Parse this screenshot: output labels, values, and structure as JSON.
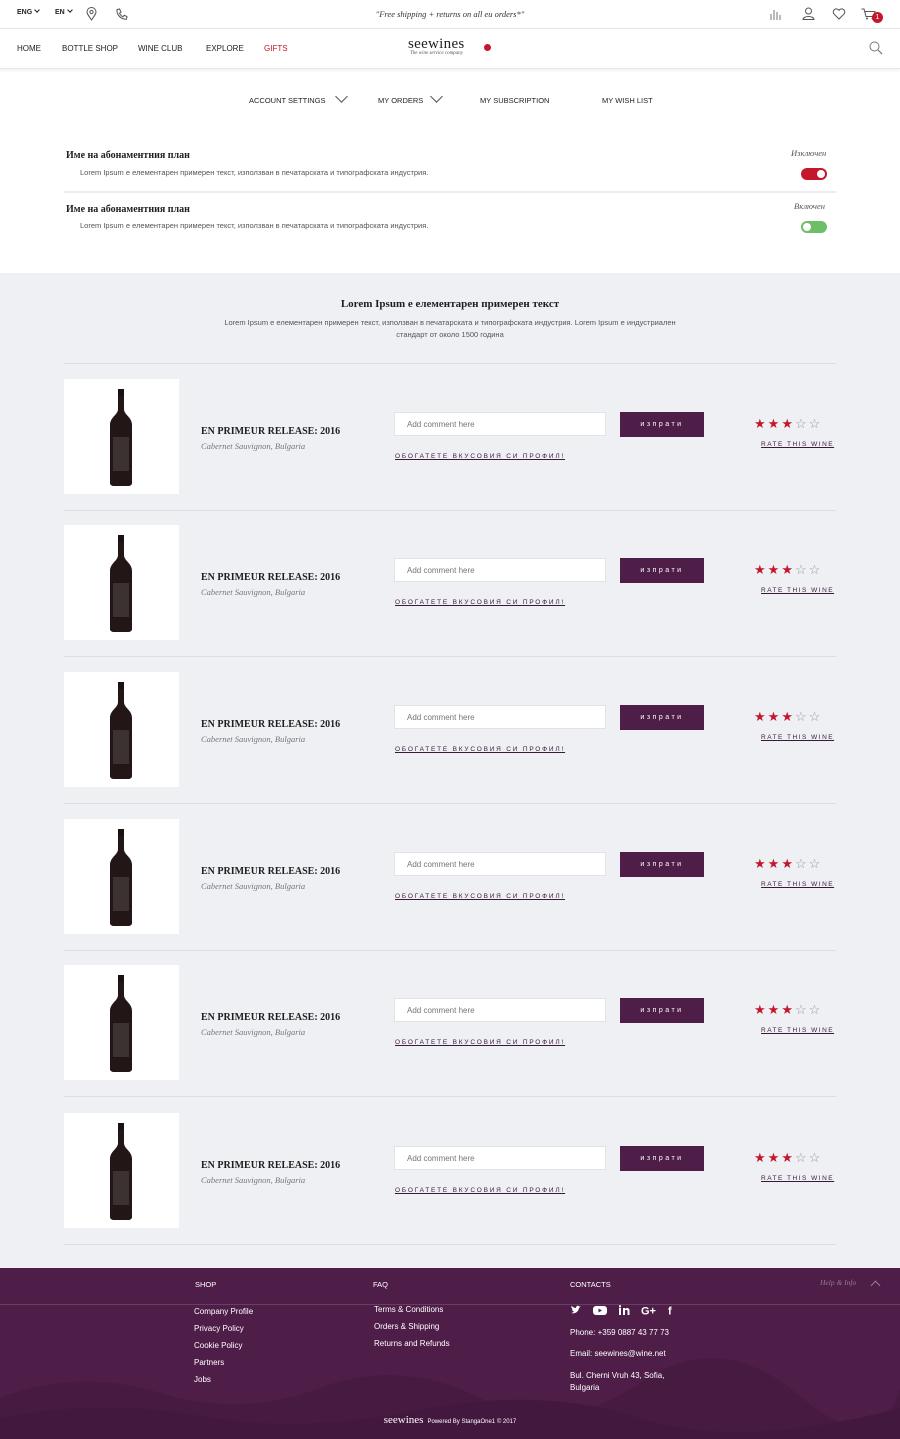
{
  "topbar": {
    "lang1": "ENG",
    "lang2": "EN",
    "promo": "\"Free shipping + returns on all eu orders*\"",
    "cart_count": "1",
    "icons": [
      "location-icon",
      "phone-icon",
      "stats-icon",
      "user-icon",
      "heart-icon",
      "cart-icon"
    ]
  },
  "nav": {
    "items": [
      "HOME",
      "BOTTLE SHOP",
      "WINE CLUB",
      "EXPLORE",
      "GIFTS"
    ],
    "logo": "seewines",
    "logo_tagline": "The wine service company",
    "active_color": "#c5172b"
  },
  "account_menu": [
    "ACCOUNT SETTINGS",
    "MY ORDERS",
    "MY SUBSCRIPTION",
    "MY WISH LIST"
  ],
  "subscriptions": [
    {
      "title": "Име на абонаментния план",
      "desc": "Lorem Ipsum е елементарен примерен текст, използван в печатарската и типографската индустрия.",
      "status": "Изключен",
      "on": false,
      "color": "#c5172b"
    },
    {
      "title": "Име на абонаментния план",
      "desc": "Lorem Ipsum е елементарен примерен текст, използван в печатарската и типографската индустрия.",
      "status": "Включен",
      "on": true,
      "color": "#6dbf67"
    }
  ],
  "intro": {
    "title": "Lorem Ipsum е елементарен примерен текст",
    "text": "Lorem Ipsum е елементарен примерен текст, използван в печатарската и типографската индустрия. Lorem Ipsum е индустриален стандарт от около 1500 година"
  },
  "items": [
    {
      "name": "EN PRIMEUR RELEASE: 2016",
      "sub": "Cabernet Sauvignon, Bulgaria",
      "placeholder": "Add comment here",
      "button": "изпрати",
      "enrich": "обогатете вкусовия си профил!",
      "rate": "RATE THIS WINE",
      "rating": 3,
      "max_rating": 5
    },
    {
      "name": "EN PRIMEUR RELEASE: 2016",
      "sub": "Cabernet Sauvignon, Bulgaria",
      "placeholder": "Add comment here",
      "button": "изпрати",
      "enrich": "обогатете вкусовия си профил!",
      "rate": "RATE THIS WINE",
      "rating": 3,
      "max_rating": 5
    },
    {
      "name": "EN PRIMEUR RELEASE: 2016",
      "sub": "Cabernet Sauvignon, Bulgaria",
      "placeholder": "Add comment here",
      "button": "изпрати",
      "enrich": "обогатете вкусовия си профил!",
      "rate": "RATE THIS WINE",
      "rating": 3,
      "max_rating": 5
    },
    {
      "name": "EN PRIMEUR RELEASE: 2016",
      "sub": "Cabernet Sauvignon, Bulgaria",
      "placeholder": "Add comment here",
      "button": "изпрати",
      "enrich": "обогатете вкусовия си профил!",
      "rate": "RATE THIS WINE",
      "rating": 3,
      "max_rating": 5
    },
    {
      "name": "EN PRIMEUR RELEASE: 2016",
      "sub": "Cabernet Sauvignon, Bulgaria",
      "placeholder": "Add comment here",
      "button": "изпрати",
      "enrich": "обогатете вкусовия си профил!",
      "rate": "RATE THIS WINE",
      "rating": 3,
      "max_rating": 5
    },
    {
      "name": "EN PRIMEUR RELEASE: 2016",
      "sub": "Cabernet Sauvignon, Bulgaria",
      "placeholder": "Add comment here",
      "button": "изпрати",
      "enrich": "обогатете вкусовия си профил!",
      "rate": "RATE THIS WINE",
      "rating": 3,
      "max_rating": 5
    }
  ],
  "footer": {
    "shop_heading": "SHOP",
    "shop_links": [
      "Company Profile",
      "Privacy Policy",
      "Cookie Policy",
      "Partners",
      "Jobs"
    ],
    "faq_heading": "FAQ",
    "faq_links": [
      "Terms & Conditions",
      "Orders & Shipping",
      "Returns and Refunds"
    ],
    "contacts_heading": "CONTACTS",
    "phone": "Phone: +359 0887 43 77  73",
    "email": "Email: seewines@wine.net",
    "address_line1": "Bul. Cherni Vruh 43, Sofia,",
    "address_line2": "Bulgaria",
    "help": "Help & Info",
    "social": [
      "twitter-icon",
      "youtube-icon",
      "linkedin-icon",
      "googleplus-icon",
      "facebook-icon"
    ],
    "logo": "seewines",
    "powered": "Powered By StangaOne1 © 2017",
    "bg_color": "#4e1d48"
  }
}
